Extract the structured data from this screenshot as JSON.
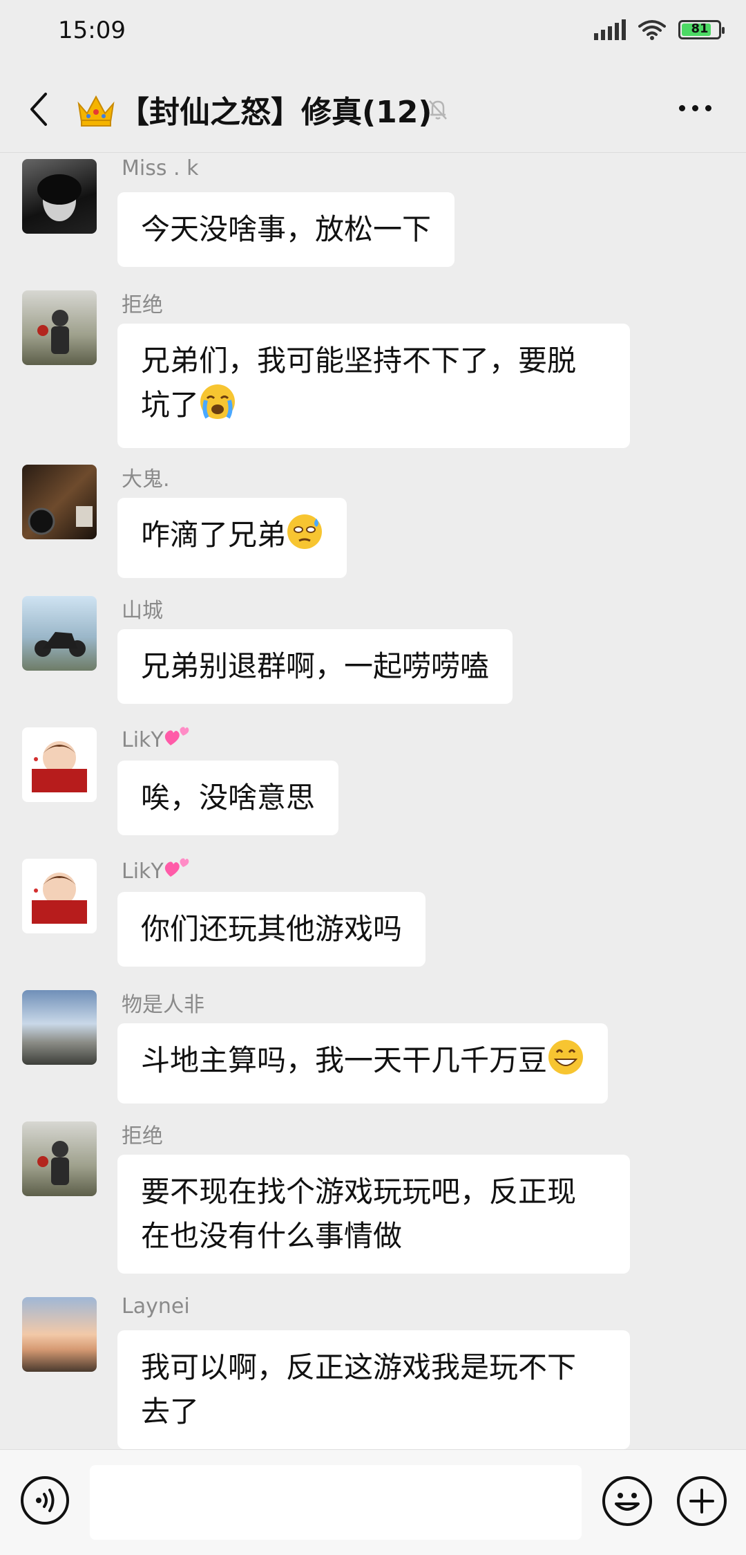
{
  "status_bar": {
    "time": "15:09",
    "battery": "81",
    "battery_level": 0.81
  },
  "header": {
    "title": "【封仙之怒】修真(12)",
    "back_icon": "back-arrow-icon",
    "crown_icon": "crown-emoji",
    "mute_icon": "bell-muted-icon",
    "more_icon": "more-dots-icon"
  },
  "messages": [
    {
      "sender": "Miss . k",
      "text": "今天没啥事，放松一下"
    },
    {
      "sender": "拒绝",
      "line1": "兄弟们，我可能坚持不下了，要脱",
      "line2": "坑了",
      "emoji": "loudly-crying-face"
    },
    {
      "sender": "大鬼.",
      "text": "咋滴了兄弟",
      "emoji": "flushed-sweat-face"
    },
    {
      "sender": "山城",
      "text": "兄弟别退群啊，一起唠唠嗑"
    },
    {
      "sender": "LikY",
      "sender_emoji": "two-hearts",
      "text": "唉，没啥意思"
    },
    {
      "sender": "LikY",
      "sender_emoji": "two-hearts",
      "text": "你们还玩其他游戏吗"
    },
    {
      "sender": "物是人非",
      "text": "斗地主算吗，我一天干几千万豆",
      "emoji": "grinning-face"
    },
    {
      "sender": "拒绝",
      "line1": "要不现在找个游戏玩玩吧，反正现",
      "line2": "在也没有什么事情做"
    },
    {
      "sender": "Laynei",
      "line1": "我可以啊，反正这游戏我是玩不下",
      "line2": "去了"
    }
  ],
  "bottom_bar": {
    "voice_icon": "voice-icon",
    "emoji_icon": "smile-icon",
    "plus_icon": "plus-icon"
  },
  "colors": {
    "background": "#ededed",
    "bubble": "#ffffff",
    "sender": "#8a8a8a"
  }
}
